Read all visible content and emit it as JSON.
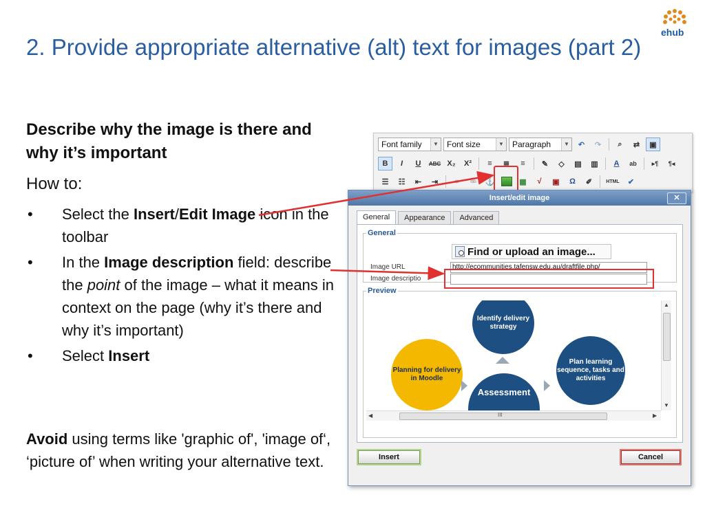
{
  "logo": {
    "text": "ehub",
    "icon": "ehub-logo-icon"
  },
  "title": "2. Provide appropriate alternative (alt) text for images (part 2)",
  "lead": "Describe why the image is there and why it’s important",
  "howto": "How to:",
  "bullets": {
    "b1": {
      "pre": "Select the ",
      "bold1": "Insert",
      "mid": "/",
      "bold2": "Edit Image",
      "post": " icon in the toolbar"
    },
    "b2": {
      "pre": "In the ",
      "bold": "Image description",
      "mid": " field: describe the ",
      "italic": "point",
      "post": " of the image – what it means in context on the page (why it’s there and why it’s important)"
    },
    "b3": {
      "pre": "Select ",
      "bold": "Insert"
    }
  },
  "avoid": {
    "bold": "Avoid",
    "text": " using terms like 'graphic of', 'image of‘, ‘picture of’ when writing your alternative text."
  },
  "toolbar": {
    "font_family": "Font family",
    "font_size": "Font size",
    "paragraph": "Paragraph",
    "bold": "B",
    "italic": "I",
    "underline": "U",
    "strike": "ABC",
    "subscript": "X₂",
    "superscript": "X²",
    "omega": "Ω",
    "html": "HTML",
    "ltr": "▸¶",
    "rtl": "¶◂"
  },
  "dialog": {
    "title": "Insert/edit image",
    "close": "✕",
    "tabs": [
      "General",
      "Appearance",
      "Advanced"
    ],
    "general_legend": "General",
    "find_button": "Find or upload an image...",
    "image_url_label": "Image URL",
    "image_url_value": "http://ecommunities.tafensw.edu.au/draftfile.php/",
    "image_desc_label": "Image descriptio",
    "image_desc_value": "",
    "preview_legend": "Preview",
    "preview": {
      "identify": "Identify delivery strategy",
      "planning": "Planning for delivery in Moodle",
      "plan_learning": "Plan learning sequence, tasks and activities",
      "assessment": "Assessment"
    },
    "scroll_mid": "III",
    "insert": "Insert",
    "cancel": "Cancel"
  },
  "colors": {
    "title": "#2a5ea0",
    "annotation": "#e03030",
    "diagram_blue": "#1d4f82",
    "diagram_yellow": "#f5b800"
  }
}
